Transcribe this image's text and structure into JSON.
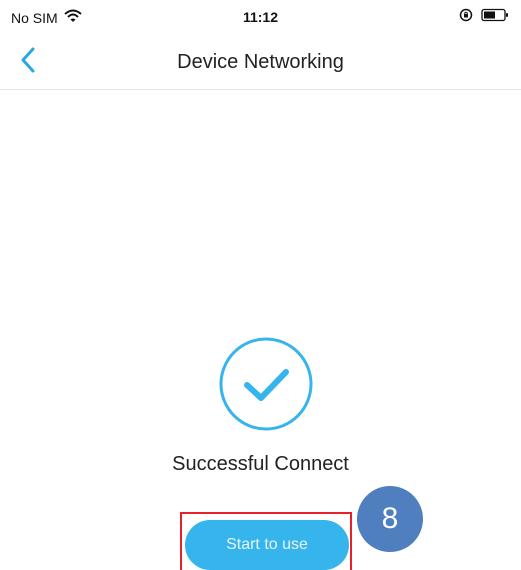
{
  "status_bar": {
    "carrier": "No SIM",
    "time": "11:12",
    "wifi_icon": "wifi-icon",
    "lock_icon": "orientation-lock-icon",
    "battery_icon": "battery-icon"
  },
  "nav": {
    "back_icon": "chevron-left-icon",
    "title": "Device Networking"
  },
  "main": {
    "success_icon": "check-circle-icon",
    "success_text": "Successful Connect",
    "start_button_label": "Start to use"
  },
  "annotation": {
    "step_number": "8"
  },
  "colors": {
    "accent": "#36b4ec",
    "highlight": "#e8202a",
    "badge": "#4f7fbe"
  }
}
